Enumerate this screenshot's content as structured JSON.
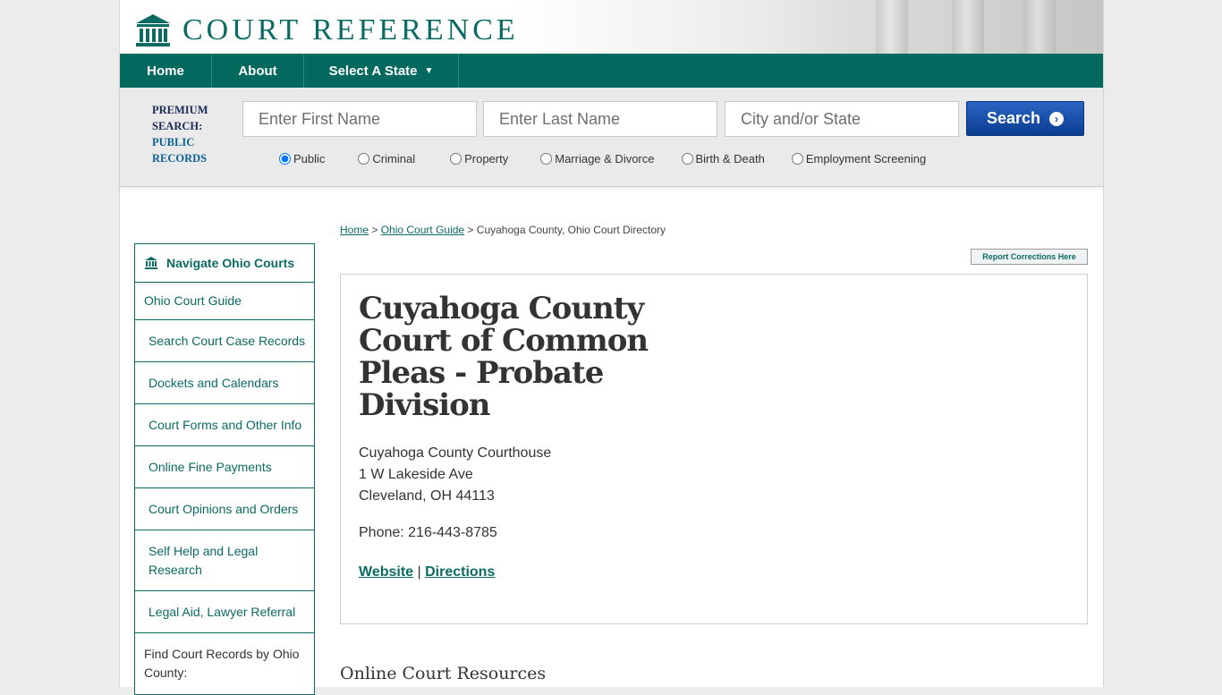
{
  "site": {
    "brand": "COURT REFERENCE",
    "brand_color": "#0b6b63"
  },
  "nav": {
    "items": [
      {
        "label": "Home"
      },
      {
        "label": "About"
      },
      {
        "label": "Select A State",
        "caret": "▼"
      }
    ]
  },
  "search": {
    "premium_label": "PREMIUM SEARCH:",
    "public_records_label": "PUBLIC RECORDS",
    "first_name_placeholder": "Enter First Name",
    "last_name_placeholder": "Enter Last Name",
    "city_state_placeholder": "City and/or State",
    "button_label": "Search",
    "selected_type": "Public",
    "types": [
      "Public",
      "Criminal",
      "Property",
      "Marriage & Divorce",
      "Birth & Death",
      "Employment Screening"
    ]
  },
  "breadcrumb": {
    "home": "Home",
    "sep1": " > ",
    "guide": "Ohio Court Guide",
    "sep2": " > ",
    "current": "Cuyahoga County, Ohio Court Directory"
  },
  "report_corrections": "Report Corrections Here",
  "court": {
    "name": "Cuyahoga County Court of Common Pleas - Probate Division",
    "address_line1": "Cuyahoga County Courthouse",
    "address_line2": "1 W Lakeside Ave",
    "address_line3": "Cleveland, OH 44113",
    "phone": "Phone: 216-443-8785",
    "website_label": "Website",
    "link_separator": " | ",
    "directions_label": "Directions"
  },
  "sidebar": {
    "title": "Navigate Ohio Courts",
    "items": [
      {
        "label": "Ohio Court Guide"
      },
      {
        "label": "Search Court Case Records"
      },
      {
        "label": "Dockets and Calendars"
      },
      {
        "label": "Court Forms and Other Info"
      },
      {
        "label": "Online Fine Payments"
      },
      {
        "label": "Court Opinions and Orders"
      },
      {
        "label": "Self Help and Legal Research"
      },
      {
        "label": "Legal Aid, Lawyer Referral"
      },
      {
        "label": "Find Court Records by Ohio County:"
      }
    ]
  },
  "resources_heading": "Online Court Resources"
}
